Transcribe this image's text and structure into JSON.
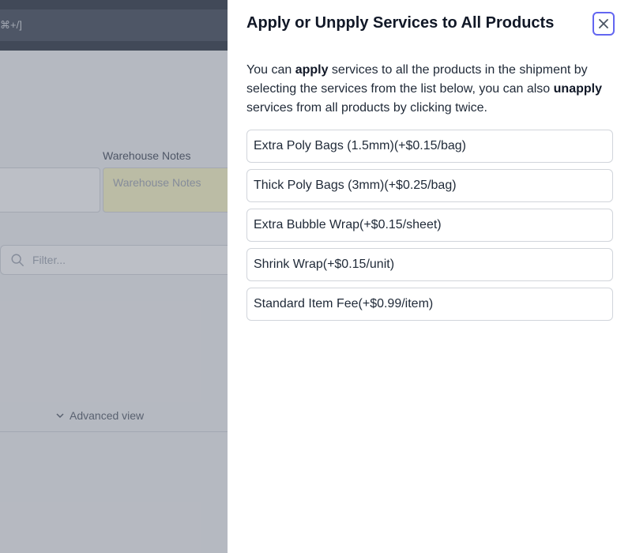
{
  "background": {
    "shortcut_hint": "⌘+/]",
    "warehouse_notes_label": "Warehouse Notes",
    "warehouse_notes_placeholder": "Warehouse Notes",
    "filter_placeholder": "Filter...",
    "advanced_view_label": "Advanced view"
  },
  "panel": {
    "title": "Apply or Unpply Services to All Products",
    "description": {
      "part1": "You can ",
      "bold1": "apply",
      "part2": " services to all the products in the shipment by selecting the services from the list below, you can also ",
      "bold2": "unapply",
      "part3": " services from all products by clicking twice."
    },
    "services": [
      {
        "label": "Extra Poly Bags (1.5mm)(+$0.15/bag)"
      },
      {
        "label": "Thick Poly Bags (3mm)(+$0.25/bag)"
      },
      {
        "label": "Extra Bubble Wrap(+$0.15/sheet)"
      },
      {
        "label": "Shrink Wrap(+$0.15/unit)"
      },
      {
        "label": "Standard Item Fee(+$0.99/item)"
      }
    ],
    "icons": {
      "close": "close-icon"
    },
    "colors": {
      "close_border": "#6366f1",
      "overlay": "#6b7280"
    }
  }
}
